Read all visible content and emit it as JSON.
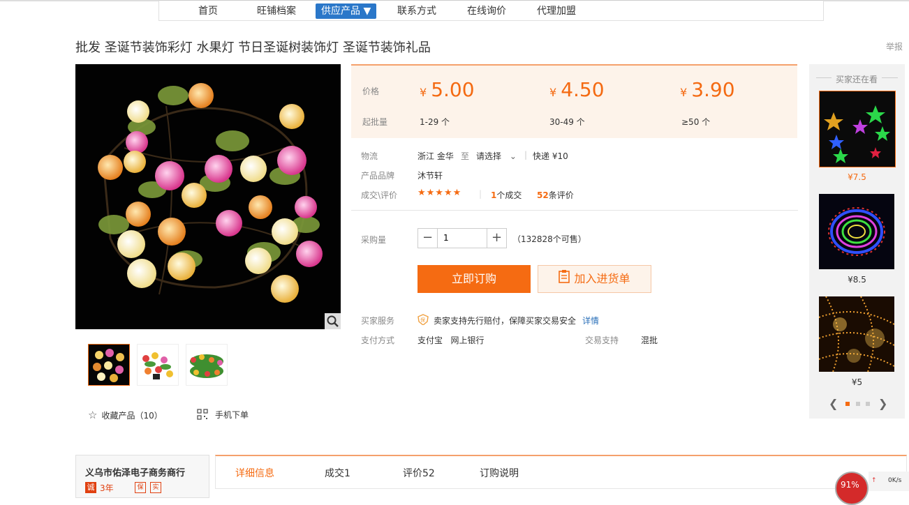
{
  "nav": {
    "items": [
      "首页",
      "旺铺档案",
      "供应产品 ▼",
      "联系方式",
      "在线询价",
      "代理加盟"
    ],
    "active_index": 2
  },
  "product": {
    "title": "批发 圣诞节装饰彩灯 水果灯 节日圣诞树装饰灯 圣诞节装饰礼品",
    "report": "举报"
  },
  "price_box": {
    "price_label": "价格",
    "moq_label": "起批量",
    "tiers": [
      {
        "currency": "¥",
        "price": "5.00",
        "range": "1-29 个"
      },
      {
        "currency": "¥",
        "price": "4.50",
        "range": "30-49 个"
      },
      {
        "currency": "¥",
        "price": "3.90",
        "range": "≥50 个"
      }
    ]
  },
  "details": {
    "logistics_label": "物流",
    "from": "浙江 金华",
    "to_word": "至",
    "destination": "请选择",
    "shipping": "快递 ¥10",
    "brand_label": "产品品牌",
    "brand": "沐节轩",
    "deals_label": "成交\\评价",
    "stars": "★★★★★",
    "deals_count": "1",
    "deals_text": "个成交",
    "reviews_count": "52",
    "reviews_text": "条评价"
  },
  "purchase": {
    "qty_label": "采购量",
    "qty_value": "1",
    "stock": "（132828个可售）",
    "buy_label": "立即订购",
    "cart_label": "加入进货单"
  },
  "service": {
    "service_label": "买家服务",
    "service_text": "卖家支持先行赔付，保障买家交易安全",
    "service_link": "详情",
    "pay_label": "支付方式",
    "pay_methods": "支付宝   网上银行",
    "trade_label": "交易支持",
    "trade_value": "混批"
  },
  "gallery": {
    "fav_label": "收藏产品（10）",
    "mobile_label": "手机下单"
  },
  "side": {
    "heading": "买家还在看",
    "items": [
      {
        "price": "¥7.5"
      },
      {
        "price": "¥8.5"
      },
      {
        "price": "¥5"
      }
    ]
  },
  "shop": {
    "name": "义乌市佑泽电子商务商行",
    "years": "3年"
  },
  "tabs": [
    "详细信息",
    "成交1",
    "评价52",
    "订购说明"
  ],
  "speed_widget": {
    "percent": "91%",
    "rate": "0K/s"
  }
}
